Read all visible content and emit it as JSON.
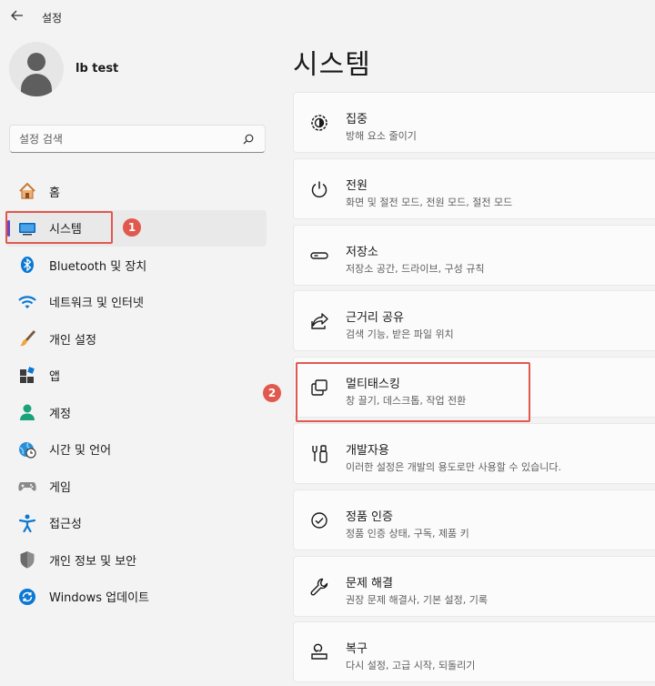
{
  "window": {
    "title": "설정"
  },
  "profile": {
    "name": "lb test"
  },
  "search": {
    "placeholder": "설정 검색"
  },
  "sidebar": {
    "items": [
      {
        "label": "홈",
        "icon": "home-icon"
      },
      {
        "label": "시스템",
        "icon": "system-display-icon",
        "active": true
      },
      {
        "label": "Bluetooth 및 장치",
        "icon": "bluetooth-icon"
      },
      {
        "label": "네트워크 및 인터넷",
        "icon": "wifi-icon"
      },
      {
        "label": "개인 설정",
        "icon": "brush-icon"
      },
      {
        "label": "앱",
        "icon": "apps-icon"
      },
      {
        "label": "계정",
        "icon": "account-icon"
      },
      {
        "label": "시간 및 언어",
        "icon": "globe-clock-icon"
      },
      {
        "label": "게임",
        "icon": "gamepad-icon"
      },
      {
        "label": "접근성",
        "icon": "accessibility-icon"
      },
      {
        "label": "개인 정보 및 보안",
        "icon": "shield-icon"
      },
      {
        "label": "Windows 업데이트",
        "icon": "update-icon"
      }
    ]
  },
  "main": {
    "title": "시스템",
    "cards": [
      {
        "title": "집중",
        "subtitle": "방해 요소 줄이기",
        "icon": "focus-icon"
      },
      {
        "title": "전원",
        "subtitle": "화면 및 절전 모드, 전원 모드, 절전 모드",
        "icon": "power-icon"
      },
      {
        "title": "저장소",
        "subtitle": "저장소 공간, 드라이브, 구성 규칙",
        "icon": "storage-icon"
      },
      {
        "title": "근거리 공유",
        "subtitle": "검색 기능, 받은 파일 위치",
        "icon": "share-icon"
      },
      {
        "title": "멀티태스킹",
        "subtitle": "창 끌기, 데스크톱, 작업 전환",
        "icon": "multitasking-icon"
      },
      {
        "title": "개발자용",
        "subtitle": "이러한 설정은 개발의 용도로만 사용할 수 있습니다.",
        "icon": "developer-tools-icon"
      },
      {
        "title": "정품 인증",
        "subtitle": "정품 인증 상태, 구독, 제품 키",
        "icon": "activation-check-icon"
      },
      {
        "title": "문제 해결",
        "subtitle": "권장 문제 해결사, 기본 설정, 기록",
        "icon": "wrench-icon"
      },
      {
        "title": "복구",
        "subtitle": "다시 설정, 고급 시작, 되돌리기",
        "icon": "recovery-icon"
      }
    ]
  },
  "annotations": {
    "step1": "1",
    "step2": "2"
  },
  "colors": {
    "highlight": "#e1594e",
    "accent_indicator": "#6b46c1",
    "system_icon": "#0067c0"
  }
}
